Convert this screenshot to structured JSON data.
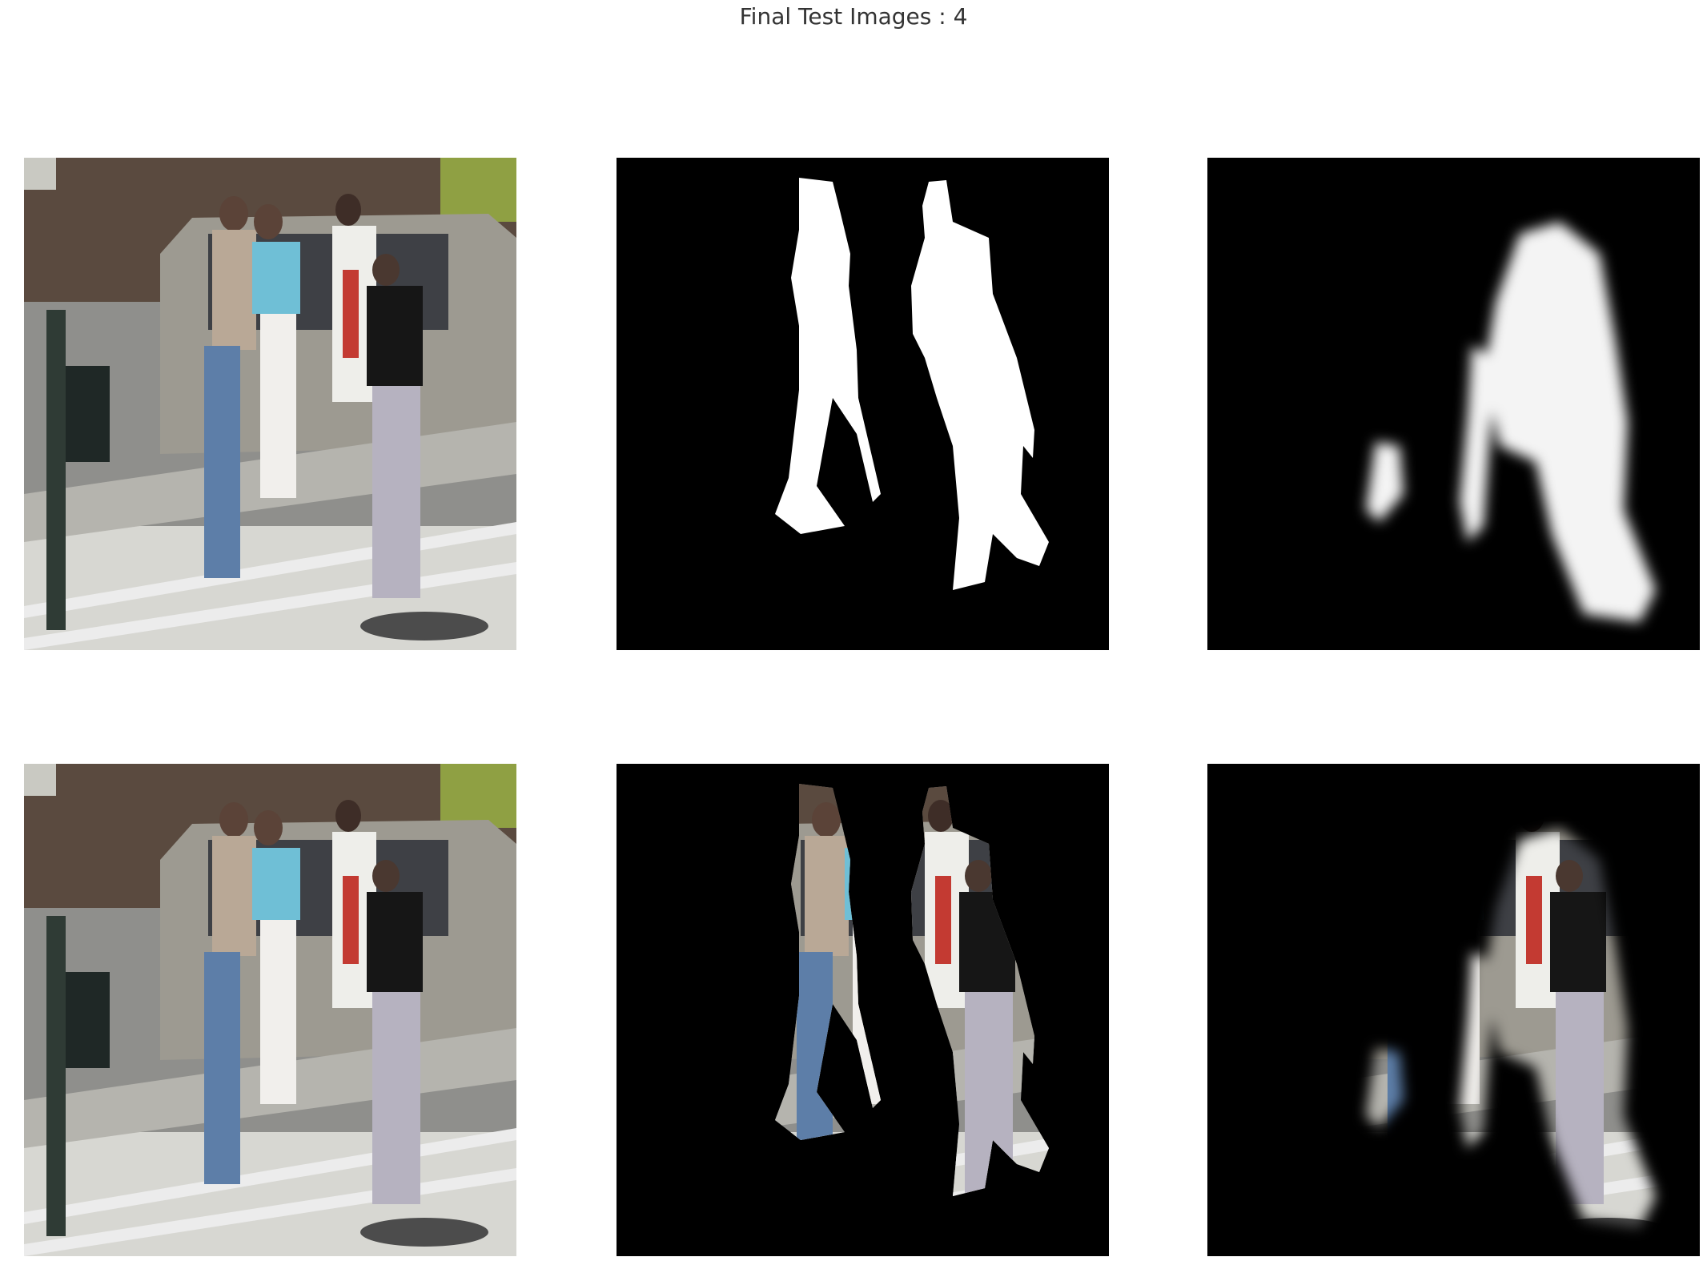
{
  "figure": {
    "title": "Final Test Images : 4",
    "colors": {
      "background": "#ffffff",
      "mask_background": "#000000",
      "mask_foreground": "#ffffff"
    },
    "panels": [
      {
        "id": "input-image",
        "content": "street photo of four pedestrians crossing a crosswalk"
      },
      {
        "id": "ground-truth-mask",
        "content": "binary white silhouettes on black"
      },
      {
        "id": "predicted-mask",
        "content": "soft blurry white prediction on black"
      },
      {
        "id": "input-image-copy",
        "content": "same street photo"
      },
      {
        "id": "ground-truth-masked-image",
        "content": "people cut out on black"
      },
      {
        "id": "predicted-masked-image",
        "content": "people cut out using predicted mask on black"
      }
    ]
  }
}
